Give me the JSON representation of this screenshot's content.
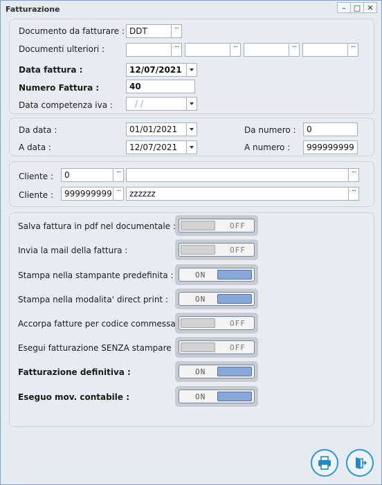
{
  "window": {
    "title": "Fatturazione",
    "minimize": "–",
    "maximize": "□",
    "close": "✕"
  },
  "doc": {
    "documento_label": "Documento da fatturare :",
    "documento_value": "DDT",
    "ulteriori_label": "Documenti ulteriori :",
    "ulteriori_values": [
      "",
      "",
      "",
      ""
    ],
    "data_fattura_label": "Data fattura :",
    "data_fattura_value": "12/07/2021",
    "numero_label": "Numero Fattura :",
    "numero_value": "40",
    "competenza_label": "Data competenza iva :",
    "competenza_value": "/ /"
  },
  "range": {
    "da_data_label": "Da data :",
    "da_data_value": "01/01/2021",
    "a_data_label": "A data :",
    "a_data_value": "12/07/2021",
    "da_numero_label": "Da numero :",
    "da_numero_value": "0",
    "a_numero_label": "A numero :",
    "a_numero_value": "999999999"
  },
  "clienti": {
    "label1": "Cliente :",
    "code1": "0",
    "name1": "",
    "label2": "Cliente :",
    "code2": "999999999",
    "name2": "zzzzzz"
  },
  "ellipsis": "···",
  "toggle_text": {
    "on": "ON",
    "off": "OFF"
  },
  "options": [
    {
      "label": "Salva fattura in pdf nel documentale :",
      "state": "off",
      "bold": false
    },
    {
      "label": "Invia la mail della fattura :",
      "state": "off",
      "bold": false
    },
    {
      "label": "Stampa nella stampante predefinita :",
      "state": "on",
      "bold": false
    },
    {
      "label": "Stampa nella modalita' direct print :",
      "state": "on",
      "bold": false
    },
    {
      "label": "Accorpa fatture per codice commessa :",
      "state": "off",
      "bold": false
    },
    {
      "label": "Esegui fatturazione SENZA stampare :",
      "state": "off",
      "bold": false
    },
    {
      "label": "Fatturazione definitiva :",
      "state": "on",
      "bold": true
    },
    {
      "label": "Eseguo mov. contabile :",
      "state": "on",
      "bold": true
    }
  ],
  "actions": {
    "print_icon": "printer-icon",
    "exit_icon": "exit-door-icon"
  },
  "colors": {
    "window_bg": "#e6ebf0",
    "accent": "#2b95d6",
    "toggle_on": "#88a8d8"
  }
}
